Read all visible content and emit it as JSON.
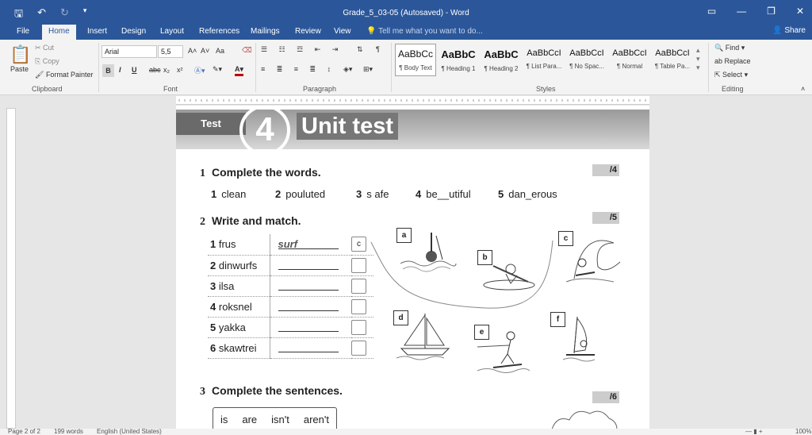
{
  "window": {
    "title": "Grade_5_03-05 (Autosaved) - Word",
    "share": "Share"
  },
  "tabs": [
    "File",
    "Home",
    "Insert",
    "Design",
    "Layout",
    "References",
    "Mailings",
    "Review",
    "View"
  ],
  "tellme": "Tell me what you want to do...",
  "ribbon": {
    "clipboard": {
      "paste": "Paste",
      "cut": "Cut",
      "copy": "Copy",
      "format_painter": "Format Painter",
      "label": "Clipboard"
    },
    "font": {
      "name": "Arial",
      "size": "5,5",
      "label": "Font",
      "case": "Aa",
      "bold": "B",
      "italic": "I",
      "underline": "U",
      "strike": "abc",
      "sub": "x₂",
      "sup": "x²"
    },
    "paragraph": {
      "label": "Paragraph"
    },
    "styles": {
      "label": "Styles",
      "items": [
        {
          "preview": "AaBbCc",
          "name": "¶ Body Text"
        },
        {
          "preview": "AaBbC",
          "name": "¶ Heading 1"
        },
        {
          "preview": "AaBbC",
          "name": "¶ Heading 2"
        },
        {
          "preview": "AaBbCcI",
          "name": "¶ List Para..."
        },
        {
          "preview": "AaBbCcI",
          "name": "¶ No Spac..."
        },
        {
          "preview": "AaBbCcI",
          "name": "¶ Normal"
        },
        {
          "preview": "AaBbCcI",
          "name": "¶ Table Pa..."
        }
      ]
    },
    "editing": {
      "find": "Find",
      "replace": "Replace",
      "select": "Select",
      "label": "Editing"
    }
  },
  "document": {
    "test_label": "Test",
    "unit_number": "4",
    "unit_title": "Unit test",
    "sections": [
      {
        "num": "1",
        "title": "Complete the words.",
        "score": "/4"
      },
      {
        "num": "2",
        "title": "Write and match.",
        "score": "/5"
      },
      {
        "num": "3",
        "title": "Complete the sentences.",
        "score": "/6"
      }
    ],
    "words": [
      {
        "n": "1",
        "text": "clean"
      },
      {
        "n": "2",
        "text": "pouluted"
      },
      {
        "n": "3",
        "text": "s afe"
      },
      {
        "n": "4",
        "text": "be__utiful"
      },
      {
        "n": "5",
        "text": "dan_erous"
      }
    ],
    "match_rows": [
      {
        "n": "1",
        "scrambled": "frus",
        "answer": "surf",
        "letter": "c"
      },
      {
        "n": "2",
        "scrambled": "dinwurfs",
        "answer": "",
        "letter": ""
      },
      {
        "n": "3",
        "scrambled": "ilsa",
        "answer": "",
        "letter": ""
      },
      {
        "n": "4",
        "scrambled": "roksnel",
        "answer": "",
        "letter": ""
      },
      {
        "n": "5",
        "scrambled": "yakka",
        "answer": "",
        "letter": ""
      },
      {
        "n": "6",
        "scrambled": "skawtrei",
        "answer": "",
        "letter": ""
      }
    ],
    "pictures": [
      "a",
      "b",
      "c",
      "d",
      "e",
      "f"
    ],
    "word_box": [
      "is",
      "are",
      "isn't",
      "aren't"
    ]
  },
  "status": {
    "page": "Page 2 of 2",
    "words": "199 words",
    "language": "English (United States)",
    "zoom": "100%"
  }
}
